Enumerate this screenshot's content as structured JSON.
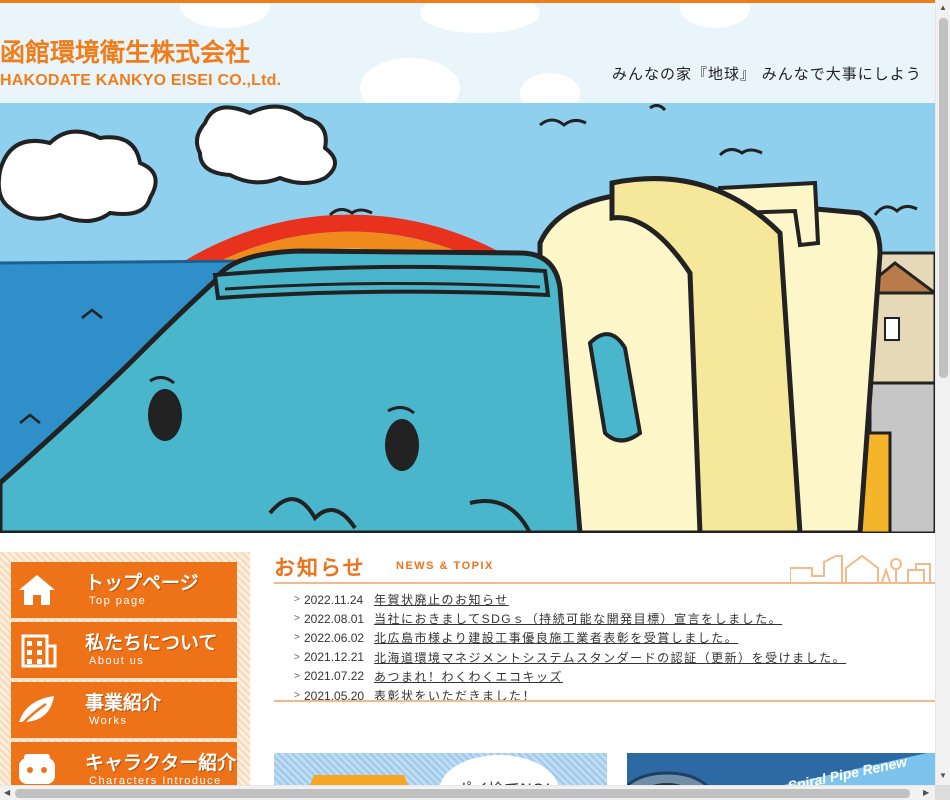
{
  "header": {
    "logo_jp": "函館環境衛生株式会社",
    "logo_en": "HAKODATE KANKYO EISEI CO.,Ltd.",
    "tagline": "みんなの家『地球』 みんなで大事にしよう"
  },
  "nav": {
    "items": [
      {
        "label": "トップページ",
        "sublabel": "Top page",
        "icon": "house-icon"
      },
      {
        "label": "私たちについて",
        "sublabel": "About us",
        "icon": "building-icon"
      },
      {
        "label": "事業紹介",
        "sublabel": "Works",
        "icon": "leaf-icon"
      },
      {
        "label": "キャラクター紹介",
        "sublabel": "Characters Introduce",
        "icon": "character-icon"
      }
    ]
  },
  "news": {
    "title": "お知らせ",
    "subtitle": "NEWS & TOPIX",
    "items": [
      {
        "date": "2022.11.24",
        "text": "年賀状廃止のお知らせ",
        "link": true
      },
      {
        "date": "2022.08.01",
        "text": "当社におきましてSDGｓ（持続可能な開発目標）宣言をしました。",
        "link": true
      },
      {
        "date": "2022.06.02",
        "text": "北広島市様より建設工事優良施工業者表彰を受賞しました。",
        "link": true
      },
      {
        "date": "2021.12.21",
        "text": "北海道環境マネジメントシステムスタンダードの認証（更新）を受けました。",
        "link": true
      },
      {
        "date": "2021.07.22",
        "text": "あつまれ！わくわくエコキッズ",
        "link": true
      },
      {
        "date": "2021.05.20",
        "text": "表彰状をいただきました！",
        "link": false
      }
    ]
  },
  "banners": {
    "left_text": "ポイ捨てNO!",
    "right_text": "Spiral Pipe Renew"
  },
  "colors": {
    "accent": "#ee7d1a",
    "nav_bg": "#ed7218",
    "sky": "#8fd0ee",
    "character": "#4ab6cc"
  }
}
